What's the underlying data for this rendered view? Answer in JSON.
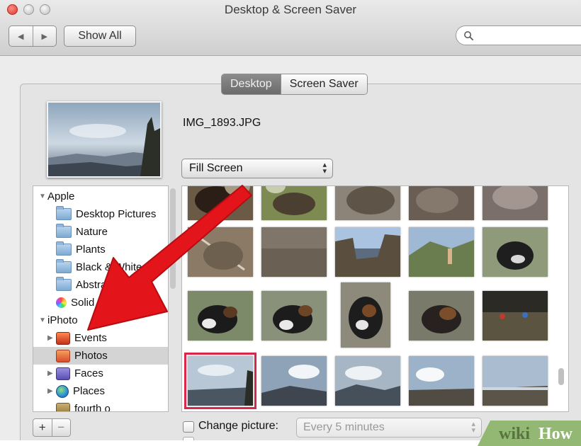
{
  "window": {
    "title": "Desktop & Screen Saver"
  },
  "toolbar": {
    "back_icon": "back-arrow-icon",
    "forward_icon": "forward-arrow-icon",
    "show_all_label": "Show All",
    "search_placeholder": ""
  },
  "tabs": [
    {
      "label": "Desktop",
      "selected": true
    },
    {
      "label": "Screen Saver",
      "selected": false
    }
  ],
  "current_picture": {
    "filename": "IMG_1893.JPG"
  },
  "fit_popup": {
    "value": "Fill Screen"
  },
  "sidebar": {
    "sections": [
      {
        "label": "Apple",
        "items": [
          "Desktop Pictures",
          "Nature",
          "Plants",
          "Black & White",
          "Abstract",
          "Solid Colors"
        ]
      },
      {
        "label": "iPhoto",
        "items": [
          "Events",
          "Photos",
          "Faces",
          "Places",
          "fourth o"
        ]
      }
    ],
    "selected_item": "Photos"
  },
  "bottom": {
    "add_label": "+",
    "remove_label": "−",
    "change_picture_label": "Change picture:",
    "interval_value": "Every 5 minutes"
  },
  "watermark": {
    "text_wiki": "wiki",
    "text_how": "How"
  },
  "colors": {
    "selection_outline": "#d9264b",
    "annotation_arrow": "#e3141a"
  }
}
